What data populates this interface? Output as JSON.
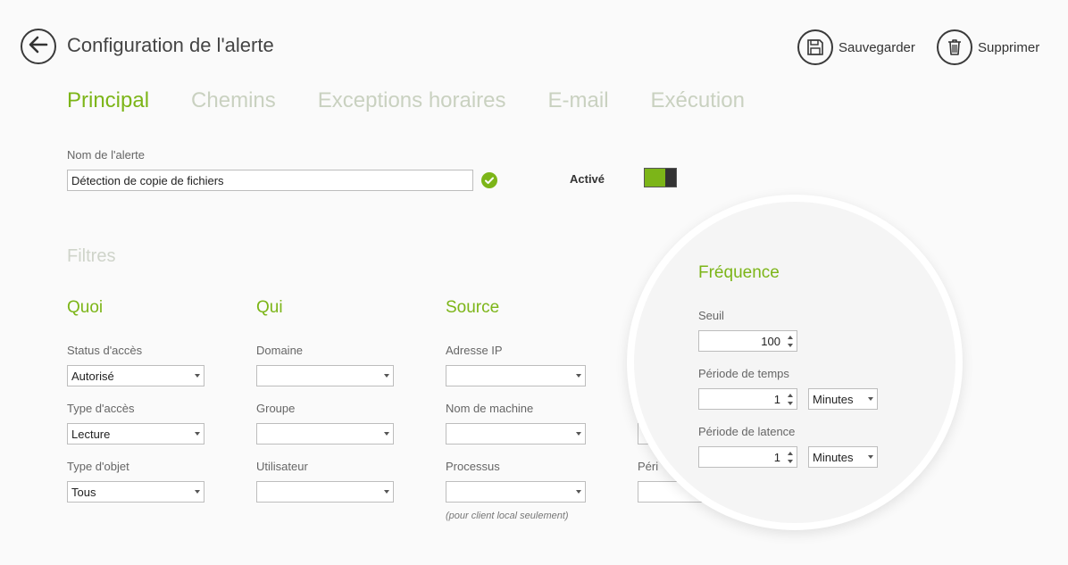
{
  "header": {
    "title": "Configuration de l'alerte",
    "save_label": "Sauvegarder",
    "delete_label": "Supprimer"
  },
  "tabs": [
    {
      "label": "Principal",
      "active": true
    },
    {
      "label": "Chemins",
      "active": false
    },
    {
      "label": "Exceptions horaires",
      "active": false
    },
    {
      "label": "E-mail",
      "active": false
    },
    {
      "label": "Exécution",
      "active": false
    }
  ],
  "alert": {
    "name_label": "Nom de l'alerte",
    "name_value": "Détection de copie de fichiers",
    "active_label": "Activé",
    "active": true
  },
  "filters": {
    "title": "Filtres",
    "quoi": {
      "title": "Quoi",
      "status_label": "Status d'accès",
      "status_value": "Autorisé",
      "type_label": "Type d'accès",
      "type_value": "Lecture",
      "object_label": "Type d'objet",
      "object_value": "Tous"
    },
    "qui": {
      "title": "Qui",
      "domain_label": "Domaine",
      "domain_value": "",
      "group_label": "Groupe",
      "group_value": "",
      "user_label": "Utilisateur",
      "user_value": ""
    },
    "source": {
      "title": "Source",
      "ip_label": "Adresse IP",
      "ip_value": "",
      "machine_label": "Nom de machine",
      "machine_value": "",
      "process_label": "Processus",
      "process_value": "",
      "process_note": "(pour client local seulement)"
    },
    "hidden_label_partial": "Péri"
  },
  "frequency": {
    "title": "Fréquence",
    "threshold_label": "Seuil",
    "threshold_value": "100",
    "period_label": "Période de temps",
    "period_value": "1",
    "period_unit": "Minutes",
    "latency_label": "Période de latence",
    "latency_value": "1",
    "latency_unit": "Minutes"
  },
  "colors": {
    "accent": "#7cb518",
    "inactive_tab": "#c9d1c0",
    "text": "#333333"
  }
}
